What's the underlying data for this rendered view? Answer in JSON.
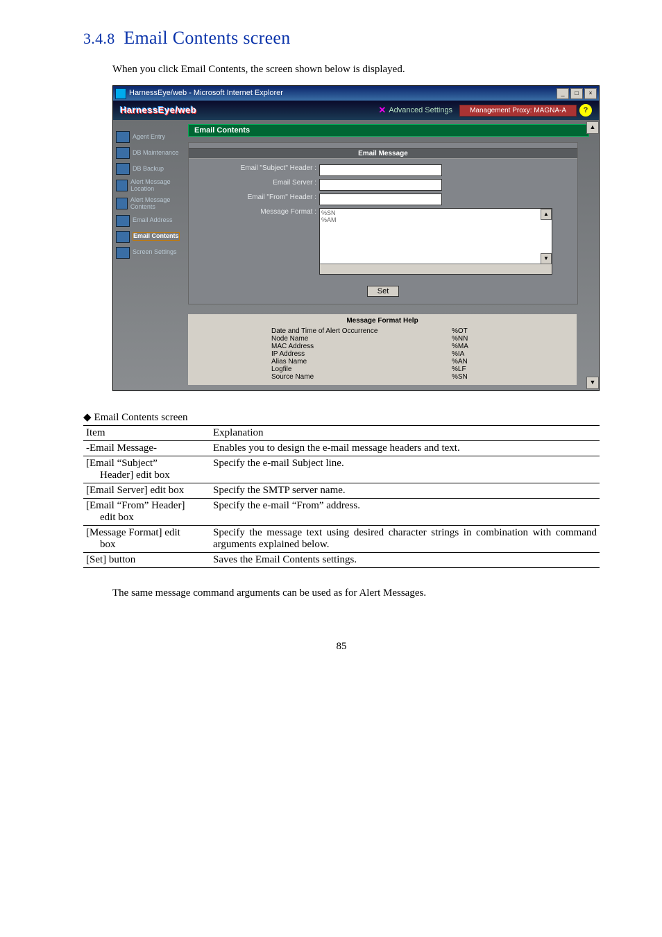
{
  "heading": {
    "number": "3.4.8",
    "title": "Email Contents screen"
  },
  "intro": "When you click Email Contents, the screen shown below is displayed.",
  "screenshot": {
    "winTitle": "HarnessEye/web - Microsoft Internet Explorer",
    "logo": "HarnessEye/web",
    "advanced": "Advanced Settings",
    "mgmtProxy": "Management Proxy: MAGNA-A",
    "helpGlyph": "?",
    "nav": {
      "items": [
        {
          "label": "Agent Entry"
        },
        {
          "label": "DB Maintenance"
        },
        {
          "label": "DB Backup"
        },
        {
          "label": "Alert Message Location"
        },
        {
          "label": "Alert Message Contents"
        },
        {
          "label": "Email Address"
        },
        {
          "label": "Email Contents",
          "selected": true
        },
        {
          "label": "Screen Settings"
        }
      ]
    },
    "panelTitle": "Email Contents",
    "form": {
      "sectionTitle": "Email Message",
      "labels": {
        "subject": "Email \"Subject\" Header :",
        "server": "Email Server :",
        "from": "Email \"From\" Header :",
        "format": "Message Format :"
      },
      "textareaLines": {
        "l1": "%SN",
        "l2": "%AM"
      },
      "setButton": "Set"
    },
    "help": {
      "title": "Message Format Help",
      "rows": [
        {
          "l": "Date and Time of Alert Occurrence",
          "c": "%OT"
        },
        {
          "l": "Node Name",
          "c": "%NN"
        },
        {
          "l": "MAC Address",
          "c": "%MA"
        },
        {
          "l": "IP Address",
          "c": "%IA"
        },
        {
          "l": "Alias Name",
          "c": "%AN"
        },
        {
          "l": "Logfile",
          "c": "%LF"
        },
        {
          "l": "Source Name",
          "c": "%SN"
        }
      ]
    }
  },
  "tableTitle": "Email Contents screen",
  "tableHead": {
    "c1": "Item",
    "c2": "Explanation"
  },
  "rows": [
    {
      "item": "-Email Message-",
      "itemIndent": "",
      "expl": "Enables you to design the e-mail message headers and text."
    },
    {
      "item": "[Email “Subject”",
      "itemIndent": "Header] edit box",
      "expl": "Specify the e-mail Subject line."
    },
    {
      "item": "[Email Server] edit box",
      "itemIndent": "",
      "expl": "Specify the SMTP server name."
    },
    {
      "item": "[Email “From” Header]",
      "itemIndent": "edit box",
      "expl": "Specify the e-mail “From” address."
    },
    {
      "item": "[Message Format] edit",
      "itemIndent": "box",
      "expl": "Specify the message text using desired character strings in combination with command arguments explained below."
    },
    {
      "item": "[Set] button",
      "itemIndent": "",
      "expl": "Saves the Email Contents settings."
    }
  ],
  "footnote": "The same message command arguments can be used as for Alert Messages.",
  "pageNumber": "85"
}
